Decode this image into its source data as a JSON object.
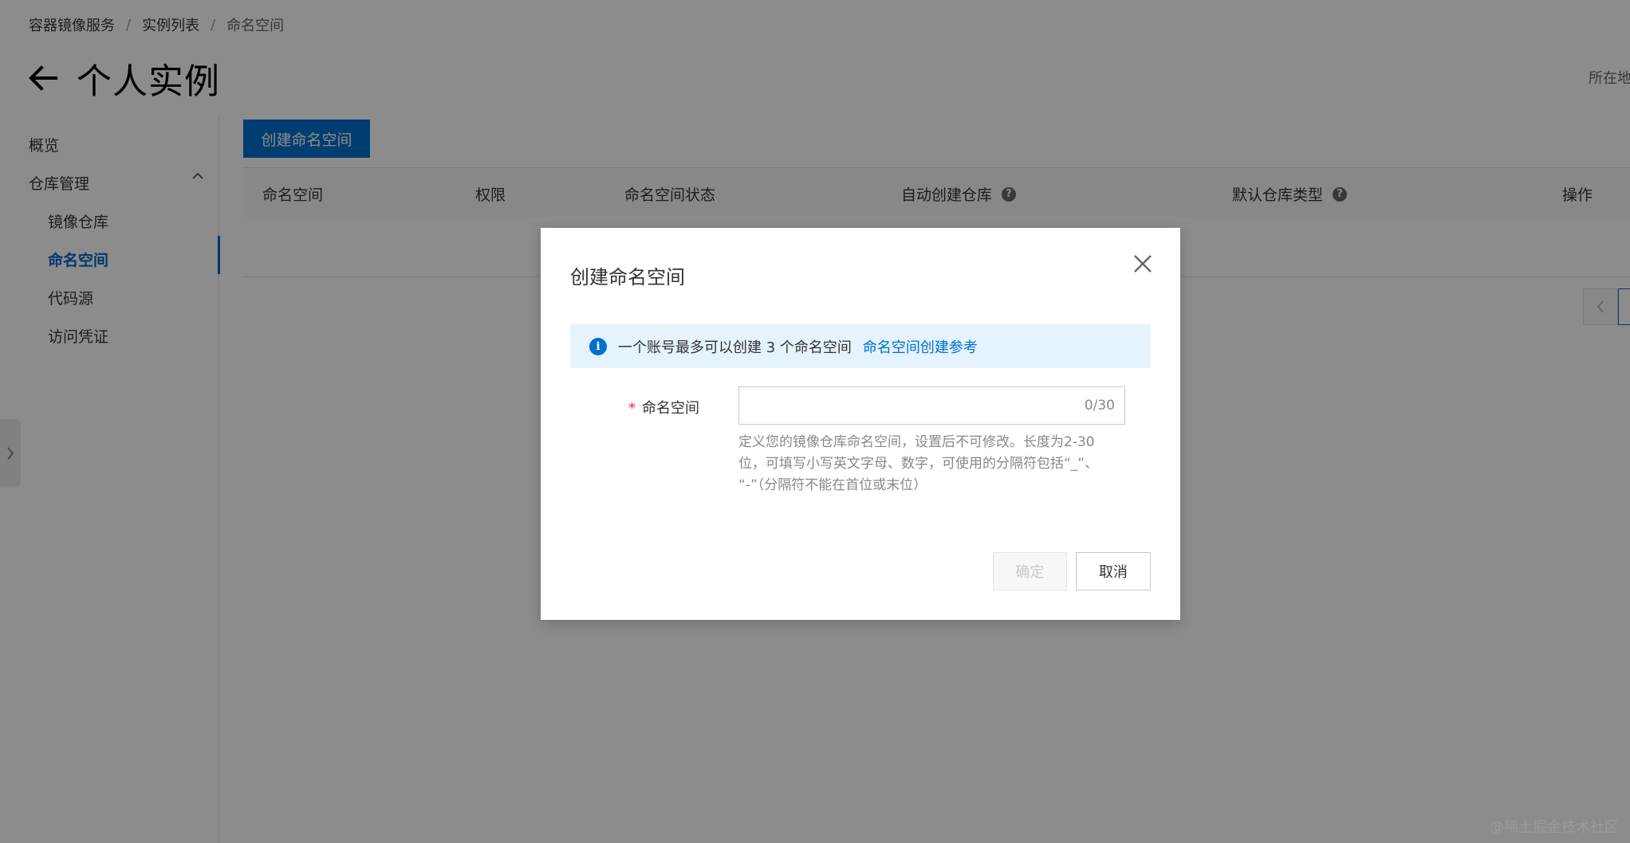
{
  "breadcrumb": {
    "items": [
      "容器镜像服务",
      "实例列表",
      "命名空间"
    ],
    "separator": "/"
  },
  "page": {
    "title": "个人实例",
    "region_label": "所在地域"
  },
  "sidebar": {
    "overview": "概览",
    "group_label": "仓库管理",
    "items": [
      {
        "label": "镜像仓库"
      },
      {
        "label": "命名空间"
      },
      {
        "label": "代码源"
      },
      {
        "label": "访问凭证"
      }
    ],
    "active_index": 1
  },
  "toolbar": {
    "create_label": "创建命名空间"
  },
  "table": {
    "columns": [
      "命名空间",
      "权限",
      "命名空间状态",
      "自动创建仓库",
      "默认仓库类型",
      "操作"
    ]
  },
  "dialog": {
    "title": "创建命名空间",
    "notice_text": "一个账号最多可以创建 3 个命名空间",
    "notice_link": "命名空间创建参考",
    "field_label": "命名空间",
    "field_value": "",
    "char_count": "0/30",
    "help_lines": [
      "定义您的镜像仓库命名空间，设置后不可修改。长度为2-30",
      "位，可填写小写英文字母、数字，可使用的分隔符包括“_”、",
      "“-”（分隔符不能在首位或末位）"
    ],
    "confirm_label": "确定",
    "cancel_label": "取消"
  },
  "watermark": "@稀土掘金技术社区",
  "colors": {
    "primary": "#0070cc",
    "notice_bg": "#e5f3fe",
    "required": "#d93026"
  }
}
